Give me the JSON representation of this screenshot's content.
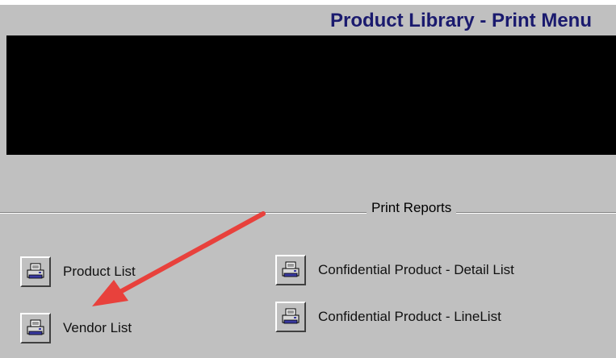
{
  "header": {
    "title": "Product Library - Print Menu"
  },
  "print_reports": {
    "group_label": "Print Reports",
    "items": [
      {
        "label": "Product List",
        "icon": "printer-icon"
      },
      {
        "label": "Vendor List",
        "icon": "printer-icon"
      },
      {
        "label": "Confidential Product - Detail List",
        "icon": "printer-icon"
      },
      {
        "label": "Confidential Product - LineList",
        "icon": "printer-icon"
      }
    ]
  },
  "colors": {
    "background": "#c0c0c0",
    "title_text": "#1a1a6e",
    "banner": "#000000",
    "annotation_arrow": "#e8413c"
  }
}
